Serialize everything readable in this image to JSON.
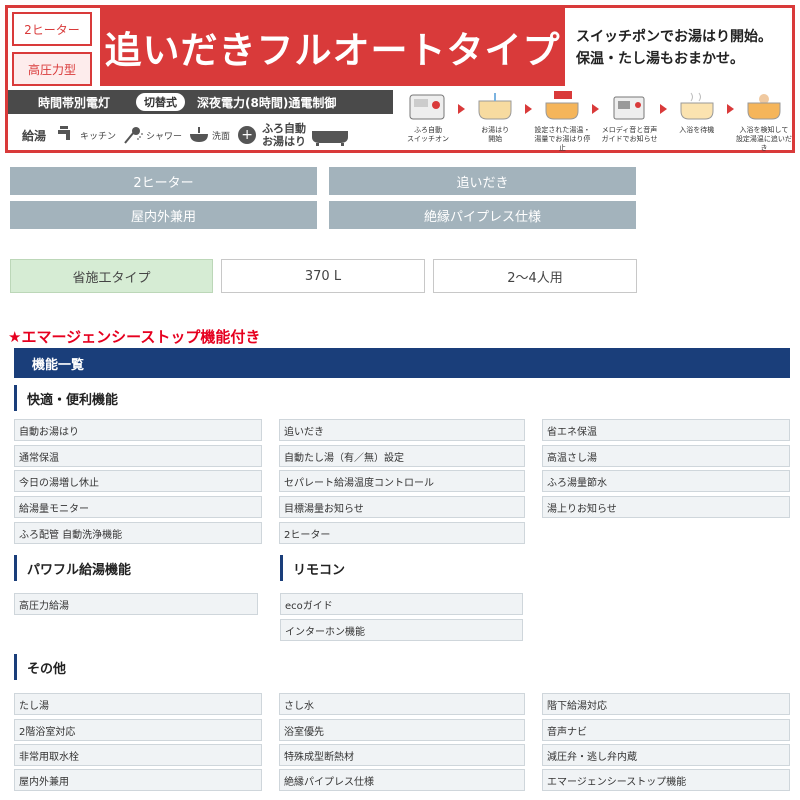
{
  "banner": {
    "tag1": "2ヒーター",
    "tag2": "高圧力型",
    "headline": "追いだきフルオートタイプ",
    "catch_line1": "スイッチポンでお湯はり開始。",
    "catch_line2": "保温・たし湯もおまかせ。",
    "bar_left": "時間帯別電灯",
    "bar_switch": "切替式",
    "bar_right": "深夜電力(8時間)通電制御",
    "kyuto": "給湯",
    "kitchen": "キッチン",
    "shower": "シャワー",
    "senmen": "洗面",
    "furo_auto_1": "ふろ自動",
    "furo_auto_2": "お湯はり",
    "steps": [
      {
        "line1": "ふろ自動",
        "line2": "スイッチオン"
      },
      {
        "line1": "お湯はり",
        "line2": "開始"
      },
      {
        "line1": "設定された湯温・",
        "line2": "湯量でお湯はり停止"
      },
      {
        "line1": "メロディ音と音声",
        "line2": "ガイドでお知らせ"
      },
      {
        "line1": "入浴を待機",
        "line2": ""
      },
      {
        "line1": "入浴を検知して",
        "line2": "設定湯温に追いだき"
      }
    ]
  },
  "specs": {
    "row1": [
      "2ヒーター",
      "追いだき"
    ],
    "row2": [
      "屋内外兼用",
      "絶縁パイプレス仕様"
    ],
    "row3": [
      "省施工タイプ",
      "370 L",
      "2〜4人用"
    ]
  },
  "emergency": "★エマージェンシーストップ機能付き",
  "features": {
    "title": "機能一覧",
    "comfort": {
      "title": "快適・便利機能",
      "col1": [
        "自動お湯はり",
        "通常保温",
        "今日の湯増し休止",
        "給湯量モニター",
        "ふろ配管 自動洗浄機能"
      ],
      "col2": [
        "追いだき",
        "自動たし湯（有／無）設定",
        "セパレート給湯温度コントロール",
        "目標湯量お知らせ",
        "2ヒーター"
      ],
      "col3": [
        "省エネ保温",
        "高温さし湯",
        "ふろ湯量節水",
        "湯上りお知らせ"
      ]
    },
    "powerful": {
      "title": "パワフル給湯機能",
      "items": [
        "高圧力給湯"
      ]
    },
    "remote": {
      "title": "リモコン",
      "items": [
        "ecoガイド",
        "インターホン機能"
      ]
    },
    "other": {
      "title": "その他",
      "col1": [
        "たし湯",
        "2階浴室対応",
        "非常用取水栓",
        "屋内外兼用"
      ],
      "col2": [
        "さし水",
        "浴室優先",
        "特殊成型断熱材",
        "絶縁パイプレス仕様"
      ],
      "col3": [
        "階下給湯対応",
        "音声ナビ",
        "減圧弁・逃し弁内蔵",
        "エマージェンシーストップ機能"
      ]
    }
  },
  "colors": {
    "accent_red": "#d93a3a",
    "navy": "#1a3e7a",
    "spec_gray": "#a3b3bc",
    "spec_green": "#d6ecd4"
  }
}
